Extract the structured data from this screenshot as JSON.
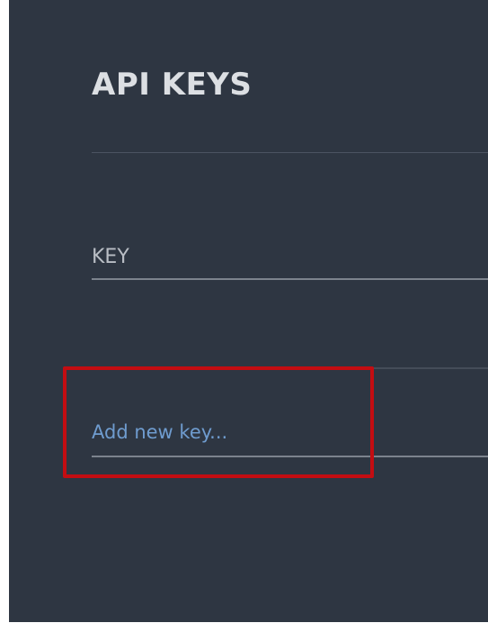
{
  "page": {
    "title": "API KEYS"
  },
  "table": {
    "columns": [
      "KEY"
    ],
    "rows": []
  },
  "add_key": {
    "placeholder": "Add new key..."
  },
  "colors": {
    "background": "#2e3642",
    "title": "#dcdfe3",
    "header_text": "#b9bec5",
    "link": "#6f9ccf",
    "highlight": "#c30d12"
  }
}
